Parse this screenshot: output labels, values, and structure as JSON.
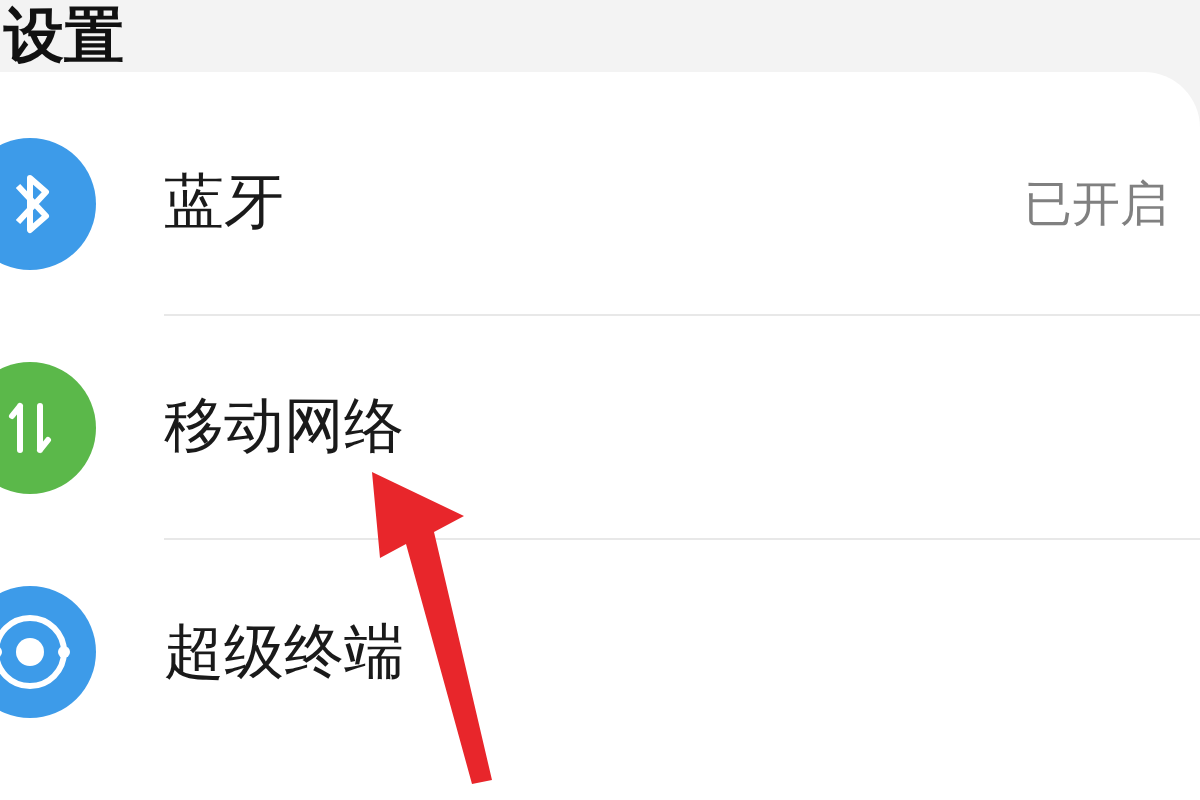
{
  "title": "设置",
  "items": [
    {
      "kind": "bluetooth",
      "label": "蓝牙",
      "value": "已开启"
    },
    {
      "kind": "mobile-network",
      "label": "移动网络"
    },
    {
      "kind": "super-terminal",
      "label": "超级终端"
    }
  ],
  "annotation": {
    "kind": "arrow"
  }
}
